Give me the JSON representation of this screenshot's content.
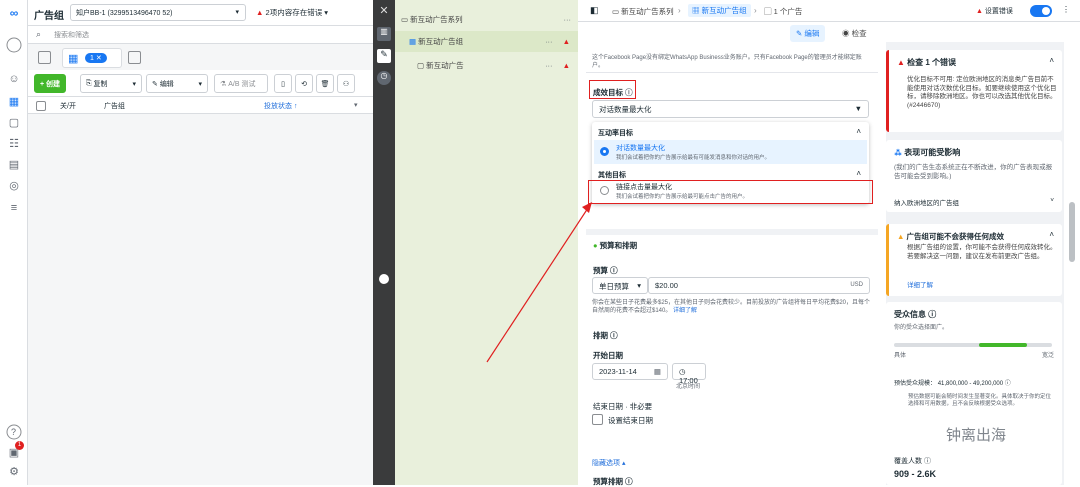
{
  "account": {
    "title": "广告组",
    "selector": "知户BB-1 (3299513496470 52)",
    "warning": "2项内容存在错误"
  },
  "search": {
    "placeholder": "搜索和筛选"
  },
  "view": {
    "selected_count": "1"
  },
  "toolbar": {
    "create": "+ 创建",
    "duplicate": "复制",
    "edit": "编辑",
    "ab_test": "A/B 测试"
  },
  "table": {
    "col_toggle": "关/开",
    "col_name": "广告组",
    "col_status": "投放状态 ↑"
  },
  "tree": {
    "campaign": "新互动广告系列",
    "adset": "新互动广告组",
    "ad": "新互动广告",
    "more": "···"
  },
  "breadcrumb": {
    "campaign": "新互动广告系列",
    "adset": "新互动广告组",
    "ad": "1 个广告",
    "settings": "设置错误"
  },
  "mode": {
    "edit": "编辑",
    "review": "检查"
  },
  "form": {
    "fb_page_note": "这个Facebook Page没有绑定WhatsApp Business业务账户。只有Facebook Page的管理员才能绑定账户。",
    "goal_label": "成效目标",
    "goal_selected": "对话数量最大化",
    "group1": "互动率目标",
    "opt1_title": "对话数量最大化",
    "opt1_desc": "我们会试着把你的广告展示给最有可能发消息和你对话的用户。",
    "group2": "其他目标",
    "opt2_title": "链接点击量最大化",
    "opt2_desc": "我们会试着把你的广告展示给最可能点击广告的用户。",
    "budget_section": "预算和排期",
    "budget_label": "预算",
    "budget_type": "单日预算",
    "budget_value": "$20.00",
    "budget_currency": "USD",
    "budget_note": "你会在某些日子花费最多$25，在其他日子则会花费较少。目前投放的广告组将每日平均花费$20，且每个自然周的花费不会超过$140。",
    "budget_note_link": "详细了解",
    "schedule_label": "排期",
    "start_label": "开始日期",
    "start_date": "2023-11-14",
    "start_time": "17:00",
    "timezone": "北京时间",
    "end_label": "结束日期 · 非必要",
    "end_checkbox": "设置结束日期",
    "hide_options": "隐藏选项 ▴",
    "schedule_bottom": "预算排期"
  },
  "errors": {
    "title": "检查 1 个错误",
    "body": "优化目标不可用: 定位欧洲地区的消息类广告目前不能使用对话次数优化目标。如要继续使用这个优化目标，请移除欧洲地区。你也可以改选其他优化目标。(#2446670)"
  },
  "impact": {
    "title": "表现可能受影响",
    "body": "(我们的广告生态系统正在不断改进，你的广告表现或报告可能会受到影响。)",
    "collapsed": "纳入欧洲地区的广告组"
  },
  "warn_card": {
    "title": "广告组可能不会获得任何成效",
    "body": "根据广告组的设置，你可能不会获得任何成效转化。若要解决这一问题，建议在发布前更改广告组。",
    "link": "详细了解"
  },
  "audience": {
    "title": "受众信息",
    "subtitle": "你的受众选择面广。",
    "narrow": "具体",
    "broad": "宽泛",
    "size_label": "预估受众规模：",
    "size_value": "41,800,000 - 49,200,000",
    "note": "预估数据可能会随时间发生显著变化。具体取决于你的定位选择和可用数据，且不会反映根据受众选项。",
    "reach_label": "覆盖人数",
    "reach_value": "909 - 2.6K"
  },
  "watermark": "钟离出海",
  "colors": {
    "accent": "#1877f2",
    "error": "#e02020",
    "green": "#42b72a"
  }
}
